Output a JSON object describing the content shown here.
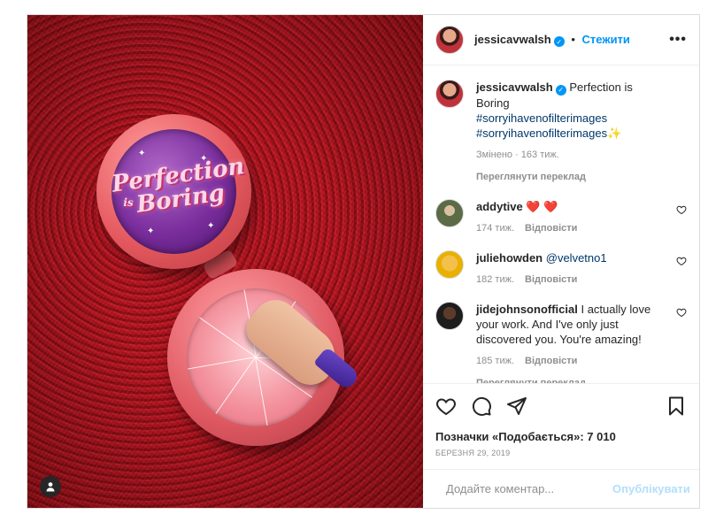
{
  "post": {
    "image": {
      "lid_word1": "Perfection",
      "lid_is": "is",
      "lid_word2": "Boring"
    }
  },
  "header": {
    "username": "jessicavwalsh",
    "separator": "•",
    "follow_label": "Стежити",
    "more_label": "•••"
  },
  "caption": {
    "username": "jessicavwalsh",
    "text": "Perfection is Boring",
    "hashtag1": "#sorryihavenofilterimages",
    "hashtag2": "#sorryihavenofilterimages",
    "emoji": "✨",
    "meta": "Змінено · 163 тиж.",
    "translate": "Переглянути переклад"
  },
  "comments": [
    {
      "username": "addytive",
      "text": "❤️ ❤️",
      "time": "174 тиж.",
      "reply": "Відповісти"
    },
    {
      "username": "juliehowden",
      "mention": "@velvetno1",
      "time": "182 тиж.",
      "reply": "Відповісти"
    },
    {
      "username": "jidejohnsonofficial",
      "text": "I actually love your work. And I've only just discovered you. You're amazing!",
      "time": "185 тиж.",
      "reply": "Відповісти",
      "translate": "Переглянути переклад"
    }
  ],
  "actions": {
    "likes_label": "Позначки «Подобається»: 7 010",
    "date": "БЕРЕЗНЯ 29, 2019"
  },
  "comment_input": {
    "placeholder": "Додайте коментар...",
    "publish_label": "Опублікувати"
  },
  "colors": {
    "accent": "#0095f6",
    "publish_disabled": "#b2dffc",
    "secondary_text": "#8e8e8e"
  }
}
